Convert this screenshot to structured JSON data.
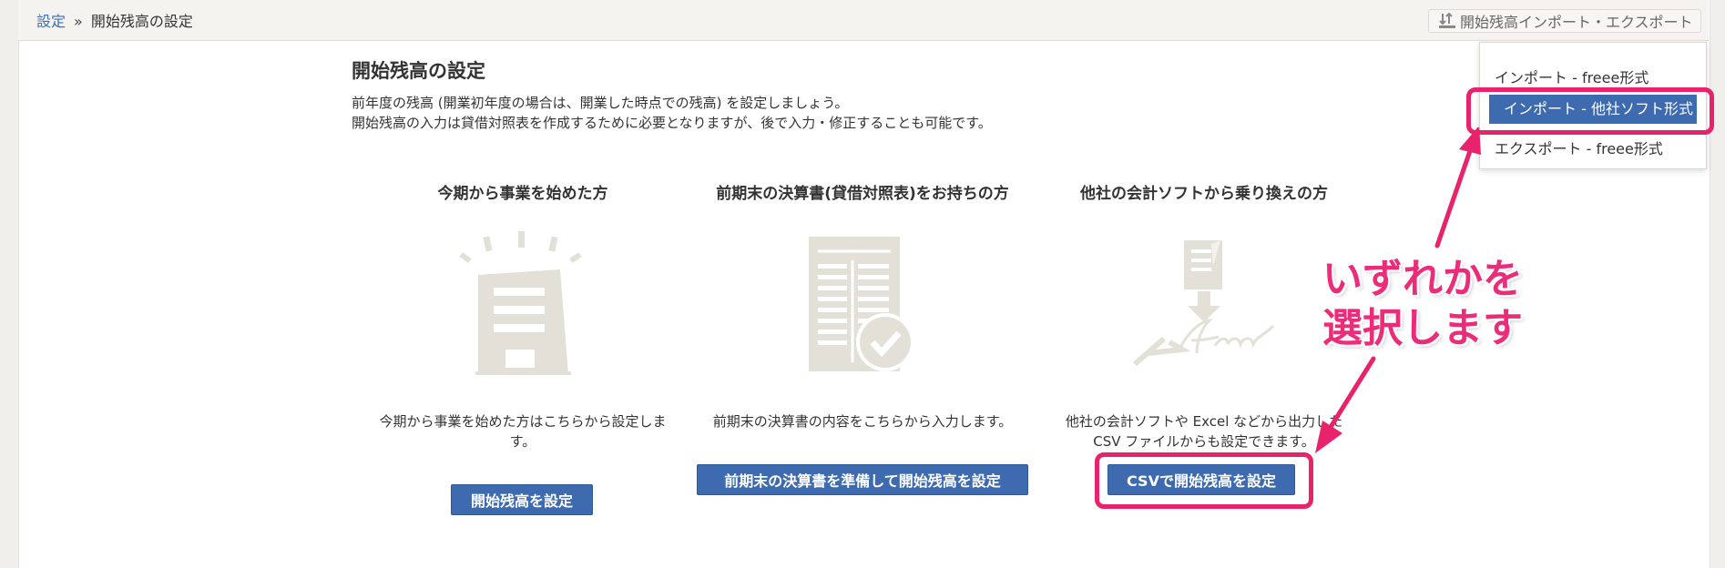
{
  "breadcrumb": {
    "root": "設定",
    "separator": "»",
    "current": "開始残高の設定"
  },
  "io_menu": {
    "button_label": "開始残高インポート・エクスポート",
    "items": [
      "インポート - freee形式",
      "インポート - 他社ソフト形式",
      "エクスポート - freee形式"
    ],
    "active_index": 1
  },
  "page": {
    "title": "開始残高の設定",
    "desc_lines": [
      "前年度の残高 (開業初年度の場合は、開業した時点での残高) を設定しましょう。",
      "開始残高の入力は貸借対照表を作成するために必要となりますが、後で入力・修正することも可能です。"
    ]
  },
  "options": [
    {
      "title": "今期から事業を始めた方",
      "text_lines": [
        "今期から事業を始めた方はこちらから設定しま",
        "す。"
      ],
      "button": "開始残高を設定"
    },
    {
      "title": "前期末の決算書(貸借対照表)をお持ちの方",
      "text_lines": [
        "前期末の決算書の内容をこちらから入力します。"
      ],
      "button": "前期末の決算書を準備して開始残高を設定"
    },
    {
      "title": "他社の会計ソフトから乗り換えの方",
      "text_lines": [
        "他社の会計ソフトや Excel などから出力した",
        "CSV ファイルからも設定できます。"
      ],
      "button": "CSVで開始残高を設定"
    }
  ],
  "annotation": {
    "lines": [
      "いずれかを",
      "選択します"
    ],
    "color": "#e8236b"
  },
  "colors": {
    "accent": "#3e6bb0",
    "highlight": "#e8236b",
    "illustration": "#e3e0d8"
  },
  "icons": [
    "import-export-icon",
    "building-icon",
    "balance-sheet-icon",
    "csv-import-icon"
  ]
}
